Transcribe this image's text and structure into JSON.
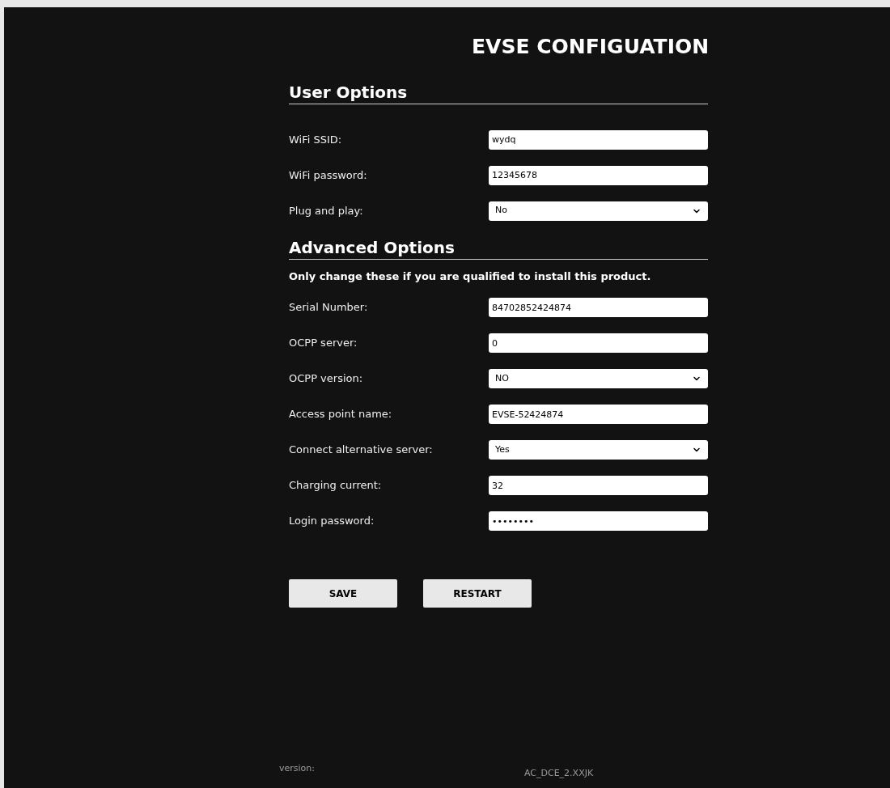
{
  "title": "EVSE CONFIGUATION",
  "sections": [
    {
      "heading": "User Options",
      "fields": [
        {
          "label": "WiFi SSID:",
          "kind": "text",
          "value": "wydq"
        },
        {
          "label": "WiFi password:",
          "kind": "text",
          "value": "12345678"
        },
        {
          "label": "Plug and play:",
          "kind": "select",
          "value": "No"
        }
      ]
    },
    {
      "heading": "Advanced Options",
      "note": "Only change these if you are qualified to install this product.",
      "fields": [
        {
          "label": "Serial Number:",
          "kind": "text",
          "value": "84702852424874"
        },
        {
          "label": "OCPP server:",
          "kind": "text",
          "value": "0"
        },
        {
          "label": "OCPP version:",
          "kind": "select",
          "value": "NO"
        },
        {
          "label": "Access point name:",
          "kind": "text",
          "value": "EVSE-52424874"
        },
        {
          "label": "Connect alternative server:",
          "kind": "select",
          "value": "Yes"
        },
        {
          "label": "Charging current:",
          "kind": "text",
          "value": "32"
        },
        {
          "label": "Login password:",
          "kind": "text",
          "value": "••••••••"
        }
      ]
    }
  ],
  "buttons": [
    "SAVE",
    "RESTART"
  ],
  "footer": {
    "label": "version:",
    "value": "AC_DCE_2.XXJK"
  }
}
